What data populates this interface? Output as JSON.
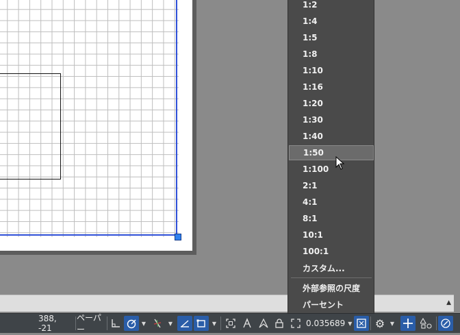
{
  "scale_menu": {
    "items": [
      "1:2",
      "1:4",
      "1:5",
      "1:8",
      "1:10",
      "1:16",
      "1:20",
      "1:30",
      "1:40",
      "1:50",
      "1:100",
      "2:1",
      "4:1",
      "8:1",
      "10:1",
      "100:1",
      "カスタム..."
    ],
    "highlighted": "1:50",
    "extra_items": [
      "外部参照の尺度",
      "パーセント"
    ]
  },
  "statusbar": {
    "coordinates": "388, -21",
    "space": "ペーパー",
    "annotation_scale": "0.035689"
  },
  "colors": {
    "viewport_border": "#2f50d8",
    "statusbar_bg": "#3f4448",
    "menu_bg": "#4a4a4a",
    "active_toggle": "#2a5da8"
  }
}
